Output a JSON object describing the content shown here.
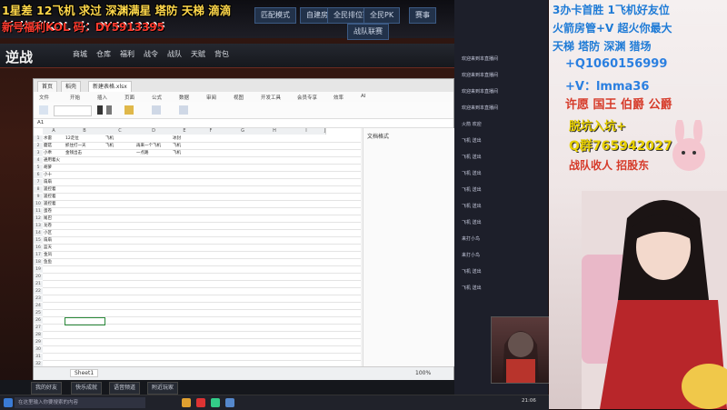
{
  "overlay": {
    "line1": "1星差 12飞机 求过 深渊满星 塔防 天梯 滴滴",
    "line2": "新号福利KOL 码：DY5913395"
  },
  "game": {
    "logo": "逆战",
    "tabs": [
      "匹配模式",
      "自建房间",
      "战队联赛",
      "全民排位赛",
      "全民PK",
      "赛事"
    ],
    "nav": [
      "商城",
      "仓库",
      "福利",
      "战令",
      "战队",
      "天赋",
      "背包"
    ],
    "bottom_buttons": [
      "我的好友",
      "快乐成就",
      "语音频道",
      "附近玩家"
    ]
  },
  "spreadsheet": {
    "tabs": [
      "首页",
      "稻壳",
      "新建表格.xlsx"
    ],
    "menu": [
      "文件",
      "开始",
      "插入",
      "页面",
      "公式",
      "数据",
      "审阅",
      "视图",
      "开发工具",
      "会员专享",
      "效率",
      "AI"
    ],
    "cell_ref": "A1",
    "columns": [
      "A",
      "B",
      "C",
      "D",
      "E",
      "F",
      "G",
      "H",
      "I",
      "J"
    ],
    "rows": [
      [
        "1",
        "水雷",
        "12走位",
        "飞机",
        "",
        "冰封",
        "",
        "",
        "",
        ""
      ],
      [
        "2",
        "蘑菇",
        "抓住打一天",
        "飞机",
        "再来一个飞机",
        "飞机",
        "",
        "",
        "",
        ""
      ],
      [
        "3",
        "小乖",
        "金钱出击",
        "",
        "一点路",
        "飞机",
        "",
        "",
        "",
        ""
      ],
      [
        "4",
        "通用着火",
        "",
        "",
        "",
        "",
        "",
        "",
        "",
        ""
      ],
      [
        "5",
        "胡萝",
        "",
        "",
        "",
        "",
        "",
        "",
        "",
        ""
      ],
      [
        "6",
        "小十",
        "",
        "",
        "",
        "",
        "",
        "",
        "",
        ""
      ],
      [
        "7",
        "扇扇",
        "",
        "",
        "",
        "",
        "",
        "",
        "",
        ""
      ],
      [
        "8",
        "遥控着",
        "",
        "",
        "",
        "",
        "",
        "",
        "",
        ""
      ],
      [
        "9",
        "遥控着",
        "",
        "",
        "",
        "",
        "",
        "",
        "",
        ""
      ],
      [
        "10",
        "遥控着",
        "",
        "",
        "",
        "",
        "",
        "",
        "",
        ""
      ],
      [
        "11",
        "蛋卷",
        "",
        "",
        "",
        "",
        "",
        "",
        "",
        ""
      ],
      [
        "12",
        "尾巴",
        "",
        "",
        "",
        "",
        "",
        "",
        "",
        ""
      ],
      [
        "13",
        "龙卷",
        "",
        "",
        "",
        "",
        "",
        "",
        "",
        ""
      ],
      [
        "14",
        "小区",
        "",
        "",
        "",
        "",
        "",
        "",
        "",
        ""
      ],
      [
        "15",
        "扇扇",
        "",
        "",
        "",
        "",
        "",
        "",
        "",
        ""
      ],
      [
        "16",
        "蓝天",
        "",
        "",
        "",
        "",
        "",
        "",
        "",
        ""
      ],
      [
        "17",
        "金凤",
        "",
        "",
        "",
        "",
        "",
        "",
        "",
        ""
      ],
      [
        "18",
        "鱼鱼",
        "",
        "",
        "",
        "",
        "",
        "",
        "",
        ""
      ]
    ],
    "sheet_tab": "Sheet1",
    "side_title": "文档格式",
    "zoom": "100%"
  },
  "chat": {
    "messages": [
      "欢迎来到本直播间",
      "欢迎来到本直播间",
      "欢迎来到本直播间",
      "欢迎来到本直播间",
      "火箭 欢迎",
      "飞机 送出",
      "飞机 送出",
      "飞机 送出",
      "飞机 送出",
      "飞机 送出",
      "飞机 送出",
      "来打小鸟",
      "来打小鸟",
      "飞机 送出",
      "飞机 送出"
    ]
  },
  "right": {
    "l1": "3办卡首胜  1飞机好友位",
    "l2": "火箭房管+V  超火你最大",
    "l3": "天梯 塔防 深渊 猎场",
    "l4": "+Q1060156999",
    "l5": "+V：lmma36",
    "l6": "许愿 国王 伯爵 公爵",
    "l7": "脱坑入坑+",
    "l8": "Q群765942027",
    "l9": "战队收人 招股东"
  },
  "taskbar": {
    "search": "在这里输入你要搜索的内容",
    "time": "21:06"
  }
}
